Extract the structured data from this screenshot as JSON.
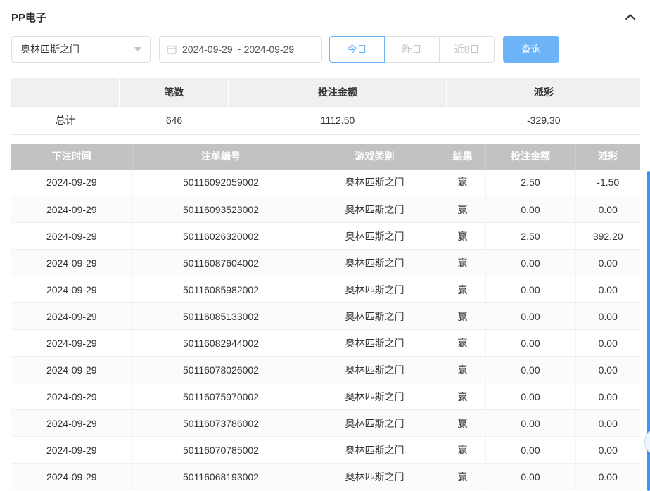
{
  "panel": {
    "title": "PP电子"
  },
  "filters": {
    "game_select": {
      "value": "奥林匹斯之门"
    },
    "date_range": {
      "value": "2024-09-29 ~ 2024-09-29"
    },
    "quick_buttons": [
      {
        "label": "今日",
        "active": true
      },
      {
        "label": "昨日",
        "active": false
      },
      {
        "label": "近8日",
        "active": false
      }
    ],
    "search_button": "查询"
  },
  "summary": {
    "headers": {
      "count": "笔数",
      "bet_amount": "投注金额",
      "payout": "派彩"
    },
    "total_label": "总计",
    "count": "646",
    "bet_amount": "1112.50",
    "payout": "-329.30"
  },
  "table": {
    "headers": [
      "下注时间",
      "注单编号",
      "游戏类别",
      "结果",
      "投注金额",
      "派彩"
    ],
    "rows": [
      {
        "date": "2024-09-29",
        "order_id": "50116092059002",
        "game": "奥林匹斯之门",
        "result": "赢",
        "bet": "2.50",
        "payout": "-1.50"
      },
      {
        "date": "2024-09-29",
        "order_id": "50116093523002",
        "game": "奥林匹斯之门",
        "result": "赢",
        "bet": "0.00",
        "payout": "0.00"
      },
      {
        "date": "2024-09-29",
        "order_id": "50116026320002",
        "game": "奥林匹斯之门",
        "result": "赢",
        "bet": "2.50",
        "payout": "392.20"
      },
      {
        "date": "2024-09-29",
        "order_id": "50116087604002",
        "game": "奥林匹斯之门",
        "result": "赢",
        "bet": "0.00",
        "payout": "0.00"
      },
      {
        "date": "2024-09-29",
        "order_id": "50116085982002",
        "game": "奥林匹斯之门",
        "result": "赢",
        "bet": "0.00",
        "payout": "0.00"
      },
      {
        "date": "2024-09-29",
        "order_id": "50116085133002",
        "game": "奥林匹斯之门",
        "result": "赢",
        "bet": "0.00",
        "payout": "0.00"
      },
      {
        "date": "2024-09-29",
        "order_id": "50116082944002",
        "game": "奥林匹斯之门",
        "result": "赢",
        "bet": "0.00",
        "payout": "0.00"
      },
      {
        "date": "2024-09-29",
        "order_id": "50116078026002",
        "game": "奥林匹斯之门",
        "result": "赢",
        "bet": "0.00",
        "payout": "0.00"
      },
      {
        "date": "2024-09-29",
        "order_id": "50116075970002",
        "game": "奥林匹斯之门",
        "result": "赢",
        "bet": "0.00",
        "payout": "0.00"
      },
      {
        "date": "2024-09-29",
        "order_id": "50116073786002",
        "game": "奥林匹斯之门",
        "result": "赢",
        "bet": "0.00",
        "payout": "0.00"
      },
      {
        "date": "2024-09-29",
        "order_id": "50116070785002",
        "game": "奥林匹斯之门",
        "result": "赢",
        "bet": "0.00",
        "payout": "0.00"
      },
      {
        "date": "2024-09-29",
        "order_id": "50116068193002",
        "game": "奥林匹斯之门",
        "result": "赢",
        "bet": "0.00",
        "payout": "0.00"
      }
    ]
  },
  "icons": {
    "collapse": "chevron-up",
    "date_picker": "calendar",
    "select": "caret-down"
  },
  "colors": {
    "accent": "#6db3f8",
    "negative": "#f05b5b",
    "table_header_bg": "#c2c2c2",
    "summary_header_bg": "#f0f0f0",
    "scrollbar": "#3b97f3"
  }
}
